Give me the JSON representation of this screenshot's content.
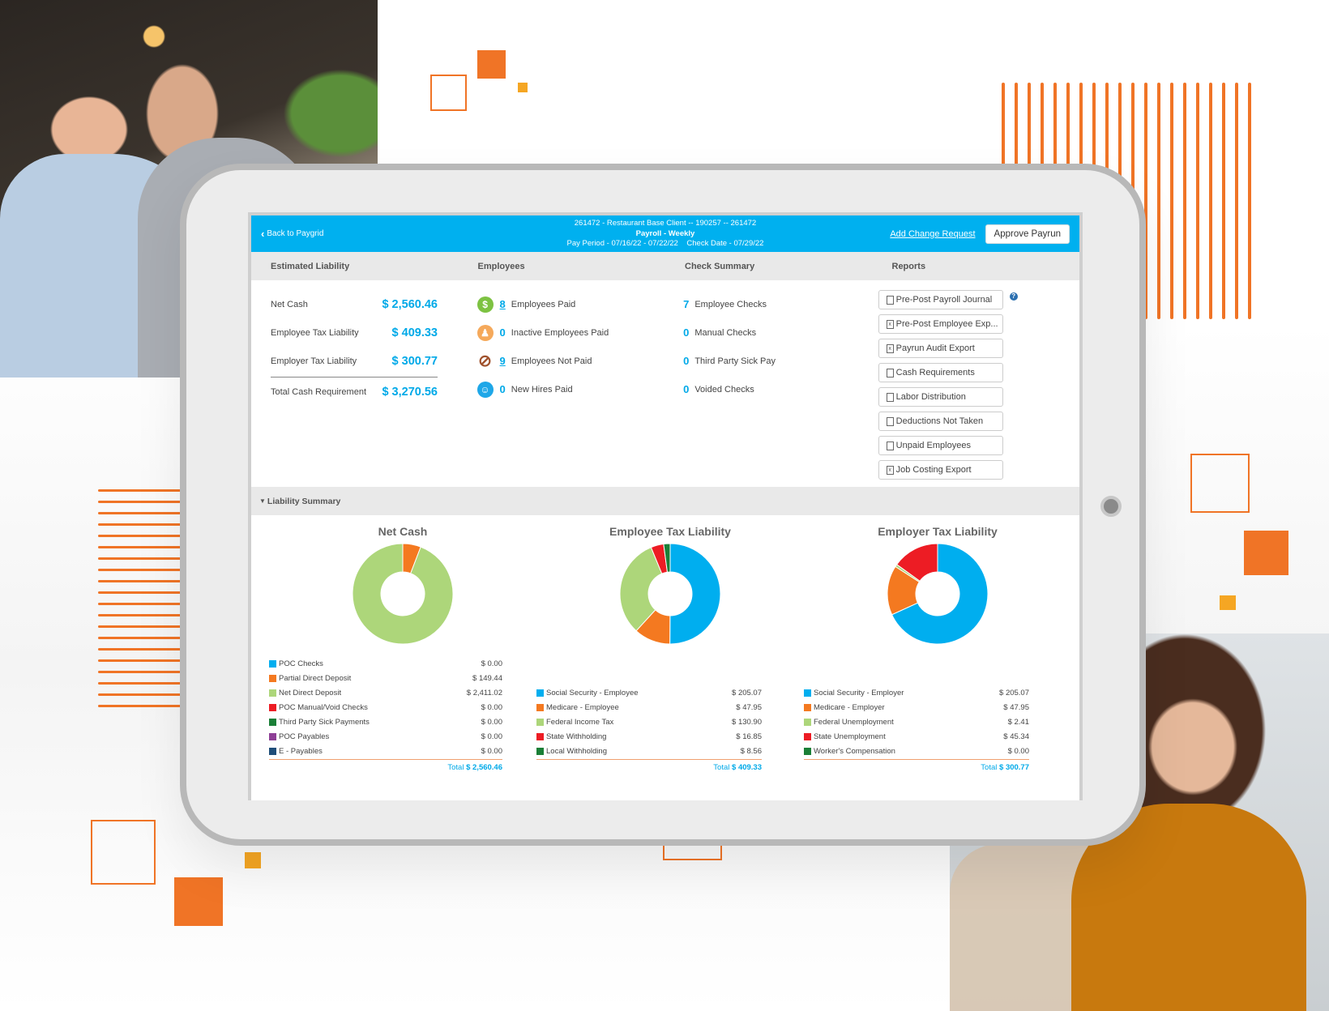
{
  "header": {
    "back_label": "Back to Paygrid",
    "client_line": "261472 - Restaurant Base Client -- 190257 -- 261472",
    "payroll_line": "Payroll - Weekly",
    "period_line": "Pay Period - 07/16/22 - 07/22/22    Check Date - 07/29/22",
    "change_request_label": "Add Change Request",
    "approve_label": "Approve Payrun"
  },
  "sections": {
    "estimated_liability": "Estimated Liability",
    "employees": "Employees",
    "check_summary": "Check Summary",
    "reports": "Reports",
    "liability_summary": "Liability Summary"
  },
  "estimated_liability": [
    {
      "label": "Net Cash",
      "value": "$ 2,560.46"
    },
    {
      "label": "Employee Tax Liability",
      "value": "$ 409.33"
    },
    {
      "label": "Employer Tax Liability",
      "value": "$ 300.77"
    },
    {
      "label": "Total Cash Requirement",
      "value": "$ 3,270.56"
    }
  ],
  "employees": [
    {
      "icon": "dollar-icon",
      "count": "8",
      "label": "Employees Paid",
      "color": "#7dc242",
      "glyph": "$"
    },
    {
      "icon": "inactive-user-icon",
      "count": "0",
      "label": "Inactive Employees Paid",
      "color": "#f5a95b",
      "glyph": "♟"
    },
    {
      "icon": "not-paid-icon",
      "count": "9",
      "label": "Employees Not Paid",
      "color": "#a0522d",
      "glyph": "⊘"
    },
    {
      "icon": "new-hire-icon",
      "count": "0",
      "label": "New Hires Paid",
      "color": "#1ea7e8",
      "glyph": "☺"
    }
  ],
  "check_summary": [
    {
      "count": "7",
      "label": "Employee Checks"
    },
    {
      "count": "0",
      "label": "Manual Checks"
    },
    {
      "count": "0",
      "label": "Third Party Sick Pay"
    },
    {
      "count": "0",
      "label": "Voided Checks"
    }
  ],
  "reports": [
    {
      "label": "Pre-Post Payroll Journal",
      "type": "pdf"
    },
    {
      "label": "Pre-Post Employee Exp...",
      "type": "xls"
    },
    {
      "label": "Payrun Audit Export",
      "type": "xls"
    },
    {
      "label": "Cash Requirements",
      "type": "pdf"
    },
    {
      "label": "Labor Distribution",
      "type": "pdf"
    },
    {
      "label": "Deductions Not Taken",
      "type": "pdf"
    },
    {
      "label": "Unpaid Employees",
      "type": "pdf"
    },
    {
      "label": "Job Costing Export",
      "type": "xls"
    }
  ],
  "colors": {
    "accent": "#00b0ef",
    "orange": "#f07426"
  },
  "chart_data": [
    {
      "type": "pie",
      "title": "Net Cash",
      "categories": [
        "POC Checks",
        "Partial Direct Deposit",
        "Net Direct Deposit",
        "POC Manual/Void Checks",
        "Third Party Sick Payments",
        "POC Payables",
        "E - Payables"
      ],
      "values": [
        0.0,
        149.44,
        2411.02,
        0.0,
        0.0,
        0.0,
        0.0
      ],
      "labels": [
        "$ 0.00",
        "$ 149.44",
        "$ 2,411.02",
        "$ 0.00",
        "$ 0.00",
        "$ 0.00",
        "$ 0.00"
      ],
      "colors": [
        "#00aeef",
        "#f47920",
        "#add67a",
        "#ed1c24",
        "#1a7f37",
        "#8e3f96",
        "#1f4e79"
      ],
      "total_label": "Total",
      "total": "$ 2,560.46"
    },
    {
      "type": "pie",
      "title": "Employee Tax Liability",
      "categories": [
        "Social Security - Employee",
        "Medicare - Employee",
        "Federal Income Tax",
        "State Withholding",
        "Local Withholding"
      ],
      "values": [
        205.07,
        47.95,
        130.9,
        16.85,
        8.56
      ],
      "labels": [
        "$ 205.07",
        "$ 47.95",
        "$ 130.90",
        "$ 16.85",
        "$ 8.56"
      ],
      "colors": [
        "#00aeef",
        "#f47920",
        "#add67a",
        "#ed1c24",
        "#1a7f37"
      ],
      "total_label": "Total",
      "total": "$ 409.33"
    },
    {
      "type": "pie",
      "title": "Employer Tax Liability",
      "categories": [
        "Social Security - Employer",
        "Medicare - Employer",
        "Federal Unemployment",
        "State Unemployment",
        "Worker's Compensation"
      ],
      "values": [
        205.07,
        47.95,
        2.41,
        45.34,
        0.0
      ],
      "labels": [
        "$ 205.07",
        "$ 47.95",
        "$ 2.41",
        "$ 45.34",
        "$ 0.00"
      ],
      "colors": [
        "#00aeef",
        "#f47920",
        "#add67a",
        "#ed1c24",
        "#1a7f37"
      ],
      "total_label": "Total",
      "total": "$ 300.77"
    }
  ]
}
